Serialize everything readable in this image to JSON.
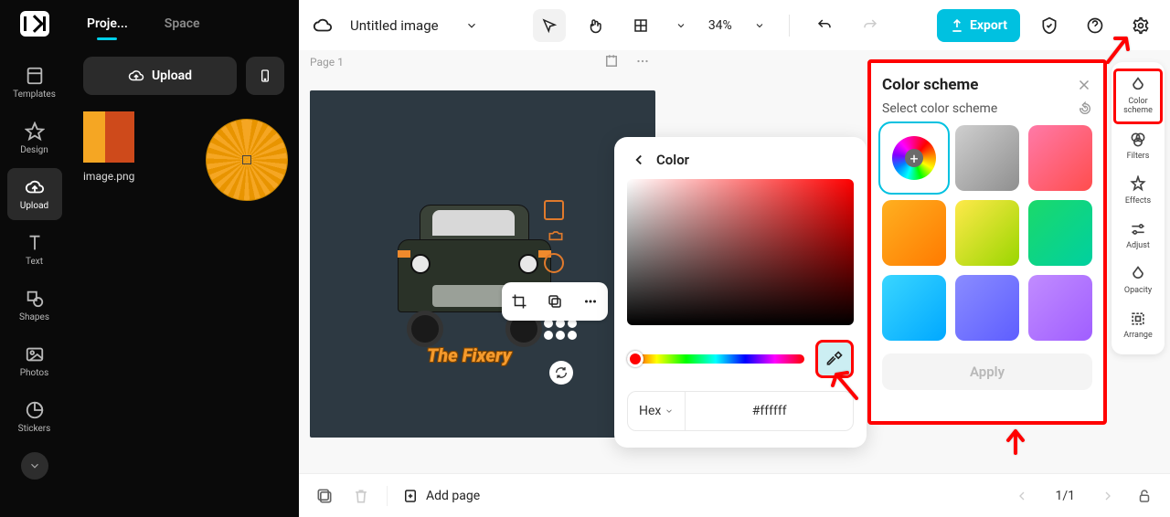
{
  "nav": {
    "items": [
      {
        "label": "Templates"
      },
      {
        "label": "Design"
      },
      {
        "label": "Upload"
      },
      {
        "label": "Text"
      },
      {
        "label": "Shapes"
      },
      {
        "label": "Photos"
      },
      {
        "label": "Stickers"
      }
    ]
  },
  "panel": {
    "tab_project": "Proje...",
    "tab_space": "Space",
    "upload": "Upload",
    "asset_name": "image.png"
  },
  "top": {
    "title": "Untitled image",
    "zoom": "34%",
    "export": "Export"
  },
  "canvas": {
    "page_label": "Page 1",
    "fixery": "The Fixery"
  },
  "color": {
    "heading": "Color",
    "hex_label": "Hex",
    "hex_value": "#ffffff"
  },
  "scheme": {
    "title": "Color scheme",
    "subtitle": "Select color scheme",
    "apply": "Apply",
    "swatches": [
      "wheel",
      "linear-gradient(135deg,#cfcfcf,#8f8f8f)",
      "linear-gradient(135deg,#ff7aa8,#ff4d4d)",
      "linear-gradient(135deg,#ffb020,#ff7a00)",
      "linear-gradient(135deg,#ffe94a,#9ad600)",
      "linear-gradient(135deg,#1bd96a,#00d0a0)",
      "linear-gradient(135deg,#3ad6ff,#00a8ff)",
      "linear-gradient(135deg,#8a8cff,#5e5eff)",
      "linear-gradient(135deg,#c18cff,#a05eff)"
    ]
  },
  "rail": {
    "items": [
      {
        "label": "Color scheme"
      },
      {
        "label": "Filters"
      },
      {
        "label": "Effects"
      },
      {
        "label": "Adjust"
      },
      {
        "label": "Opacity"
      },
      {
        "label": "Arrange"
      }
    ]
  },
  "bottom": {
    "add_page": "Add page",
    "page": "1/1"
  }
}
